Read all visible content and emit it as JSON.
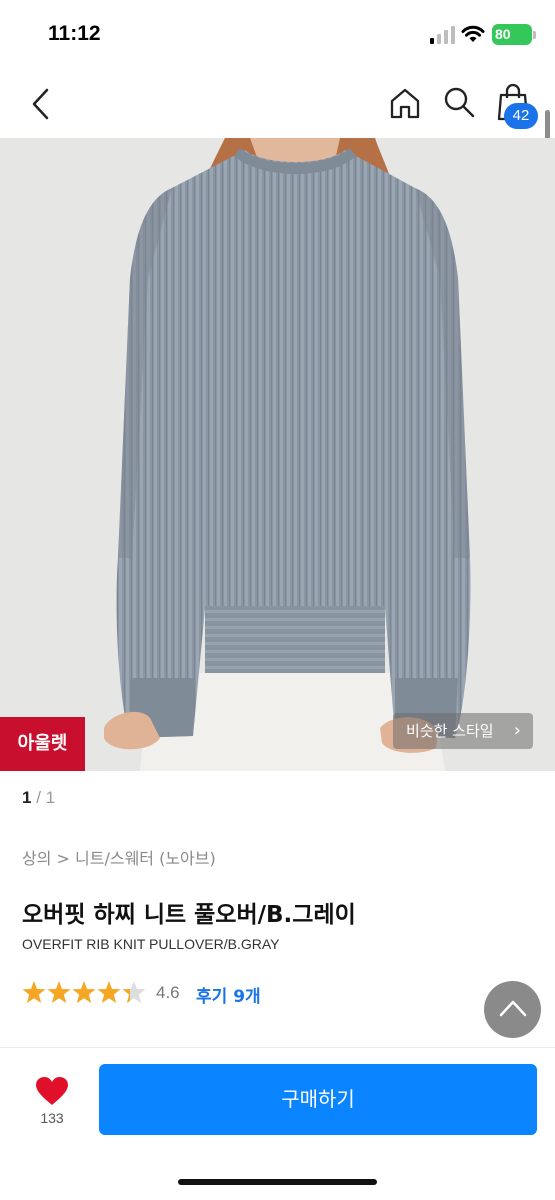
{
  "status_bar": {
    "time": "11:12",
    "battery": "80"
  },
  "nav": {
    "back_icon": "chevron-left-icon",
    "home_icon": "home-icon",
    "search_icon": "search-icon",
    "bag_icon": "shopping-bag-icon",
    "bag_count": "42"
  },
  "product": {
    "badge": "아울렛",
    "similar_style": "비슷한 스타일",
    "similar_chevron": "›",
    "pager": {
      "current": "1",
      "sep": "/",
      "total": "1"
    },
    "category": "상의 > 니트/스웨터 (노아브)",
    "title_ko": "오버핏 하찌 니트 풀오버/B.그레이",
    "title_en": "OVERFIT RIB KNIT PULLOVER/B.GRAY",
    "rating": "4.6",
    "rating_stars": 4.6,
    "reviews": "후기 9개"
  },
  "bottom": {
    "like_count": "133",
    "buy_label": "구매하기"
  },
  "colors": {
    "accent": "#0a84ff",
    "badge_red": "#c8102e",
    "star": "#f5a623",
    "heart": "#e0102b"
  }
}
